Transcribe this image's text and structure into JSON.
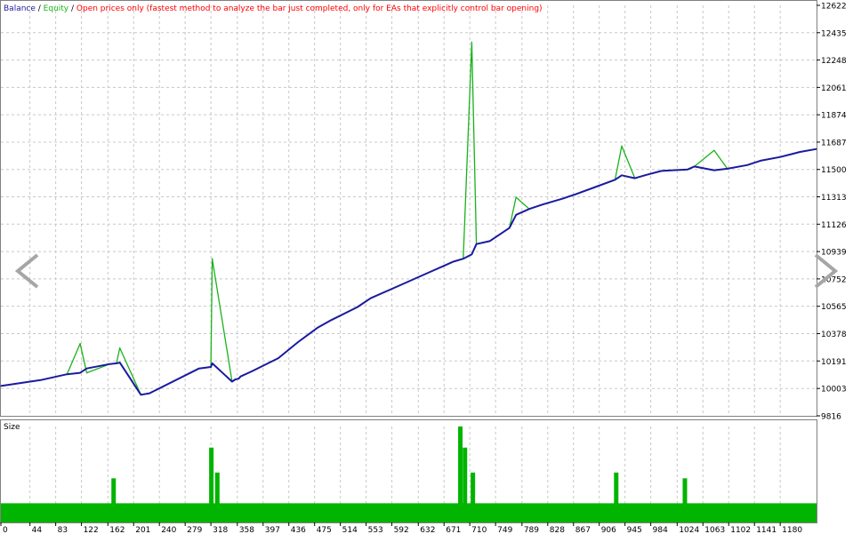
{
  "legend": {
    "balance": "Balance",
    "sep1": " / ",
    "equity": "Equity",
    "sep2": " / ",
    "mode": "Open prices only (fastest method to analyze the bar just completed, only for EAs that explicitly control bar opening)"
  },
  "size_panel": {
    "label": "Size"
  },
  "colors": {
    "balance": "#1a1aa0",
    "equity": "#19b219",
    "mode_text": "#ff0000",
    "volume": "#00b400",
    "grid": "#c8c8c8",
    "axis_text": "#000000"
  },
  "icons": {
    "prev": "chevron-left-icon",
    "next": "chevron-right-icon"
  },
  "chart_data": [
    {
      "type": "line",
      "series": [
        {
          "name": "Balance",
          "x": [
            0,
            60,
            100,
            120,
            130,
            165,
            175,
            180,
            212,
            225,
            300,
            318,
            320,
            350,
            355,
            360,
            363,
            380,
            420,
            450,
            480,
            500,
            540,
            560,
            600,
            650,
            670,
            685,
            700,
            713,
            720,
            740,
            770,
            780,
            800,
            820,
            850,
            870,
            900,
            930,
            940,
            960,
            975,
            1000,
            1040,
            1050,
            1080,
            1100,
            1130,
            1150,
            1180,
            1210,
            1235
          ],
          "y": [
            10020,
            10060,
            10100,
            10110,
            10140,
            10170,
            10175,
            10180,
            9960,
            9970,
            10140,
            10150,
            10175,
            10050,
            10065,
            10070,
            10085,
            10120,
            10210,
            10320,
            10420,
            10470,
            10560,
            10620,
            10700,
            10800,
            10840,
            10870,
            10890,
            10920,
            10990,
            11010,
            11100,
            11190,
            11230,
            11260,
            11300,
            11330,
            11380,
            11430,
            11460,
            11440,
            11460,
            11490,
            11500,
            11520,
            11495,
            11505,
            11530,
            11560,
            11585,
            11620,
            11640
          ]
        },
        {
          "name": "Equity",
          "x": [
            0,
            60,
            100,
            120,
            130,
            165,
            175,
            180,
            212,
            225,
            300,
            318,
            320,
            350,
            355,
            360,
            363,
            380,
            420,
            450,
            480,
            500,
            540,
            560,
            600,
            650,
            670,
            685,
            700,
            713,
            720,
            740,
            770,
            780,
            800,
            820,
            850,
            870,
            900,
            930,
            940,
            960,
            975,
            1000,
            1040,
            1050,
            1080,
            1100,
            1130,
            1150,
            1180,
            1210,
            1235
          ],
          "y": [
            10020,
            10060,
            10100,
            10310,
            10110,
            10170,
            10175,
            10280,
            9960,
            9970,
            10140,
            10150,
            10890,
            10050,
            10065,
            10070,
            10085,
            10120,
            10210,
            10320,
            10420,
            10470,
            10560,
            10620,
            10700,
            10800,
            10840,
            10870,
            10890,
            12370,
            10990,
            11010,
            11100,
            11310,
            11230,
            11260,
            11300,
            11330,
            11380,
            11430,
            11660,
            11440,
            11460,
            11490,
            11500,
            11520,
            11630,
            11505,
            11530,
            11560,
            11585,
            11620,
            11640
          ]
        }
      ],
      "ylim": [
        9816,
        12622
      ],
      "yticks": [
        9816,
        10003,
        10191,
        10378,
        10565,
        10752,
        10939,
        11126,
        11313,
        11500,
        11687,
        11874,
        12061,
        12248,
        12435,
        12622
      ],
      "xlim": [
        0,
        1235
      ],
      "xticks": [
        0,
        44,
        83,
        122,
        162,
        201,
        240,
        279,
        318,
        358,
        397,
        436,
        475,
        514,
        553,
        592,
        632,
        671,
        710,
        749,
        789,
        828,
        867,
        906,
        945,
        984,
        1024,
        1063,
        1102,
        1141,
        1180
      ],
      "grid": true
    },
    {
      "type": "bar",
      "title": "Size",
      "baseline": 1,
      "ylim": [
        0,
        5
      ],
      "spikes": [
        {
          "x": 170,
          "value": 2.3
        },
        {
          "x": 318,
          "value": 3.9
        },
        {
          "x": 327,
          "value": 2.6
        },
        {
          "x": 695,
          "value": 5.0
        },
        {
          "x": 702,
          "value": 3.9
        },
        {
          "x": 714,
          "value": 2.6
        },
        {
          "x": 931,
          "value": 2.6
        },
        {
          "x": 1035,
          "value": 2.3
        }
      ]
    }
  ]
}
